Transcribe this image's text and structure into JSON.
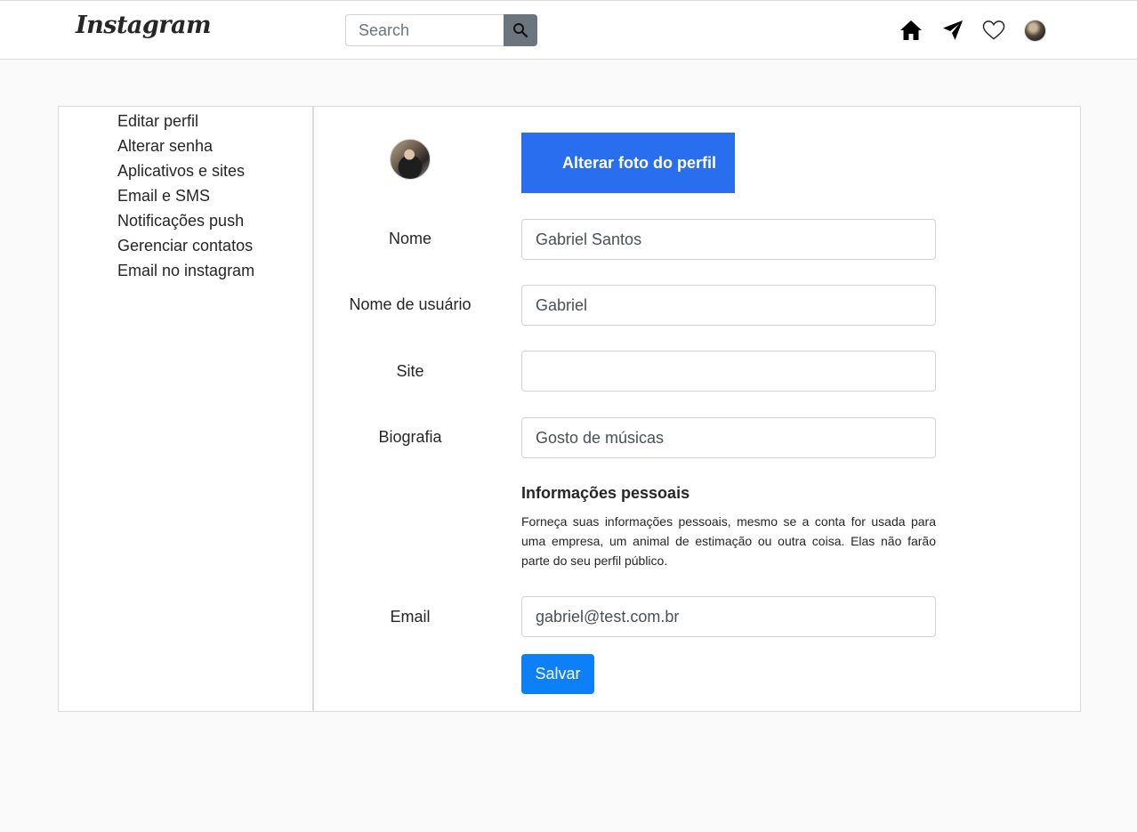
{
  "header": {
    "logo": "Instagram",
    "search_placeholder": "Search",
    "icons": [
      "search-icon",
      "home-icon",
      "paper-plane-icon",
      "heart-icon",
      "avatar"
    ]
  },
  "sidebar": {
    "items": [
      {
        "label": "Editar perfil"
      },
      {
        "label": "Alterar senha"
      },
      {
        "label": "Aplicativos e sites"
      },
      {
        "label": "Email e SMS"
      },
      {
        "label": "Notificações push"
      },
      {
        "label": "Gerenciar contatos"
      },
      {
        "label": "Email no instagram"
      }
    ]
  },
  "profile": {
    "change_photo_label": "Alterar foto do perfil"
  },
  "form": {
    "name_label": "Nome",
    "name_value": "Gabriel Santos",
    "username_label": "Nome de usuário",
    "username_value": "Gabriel",
    "site_label": "Site",
    "site_value": "",
    "bio_label": "Biografia",
    "bio_value": "Gosto de músicas",
    "info_title": "Informações pessoais",
    "info_text": "Forneça suas informações pessoais, mesmo se a conta for usada para uma empresa, um animal de estimação ou outra coisa. Elas não farão parte do seu perfil público.",
    "email_label": "Email",
    "email_value": "gabriel@test.com.br",
    "save_label": "Salvar"
  },
  "colors": {
    "primary_button": "#2a6ef0",
    "save_button": "#0d7ff7",
    "search_button": "#6c757d",
    "background": "#fafafa"
  }
}
